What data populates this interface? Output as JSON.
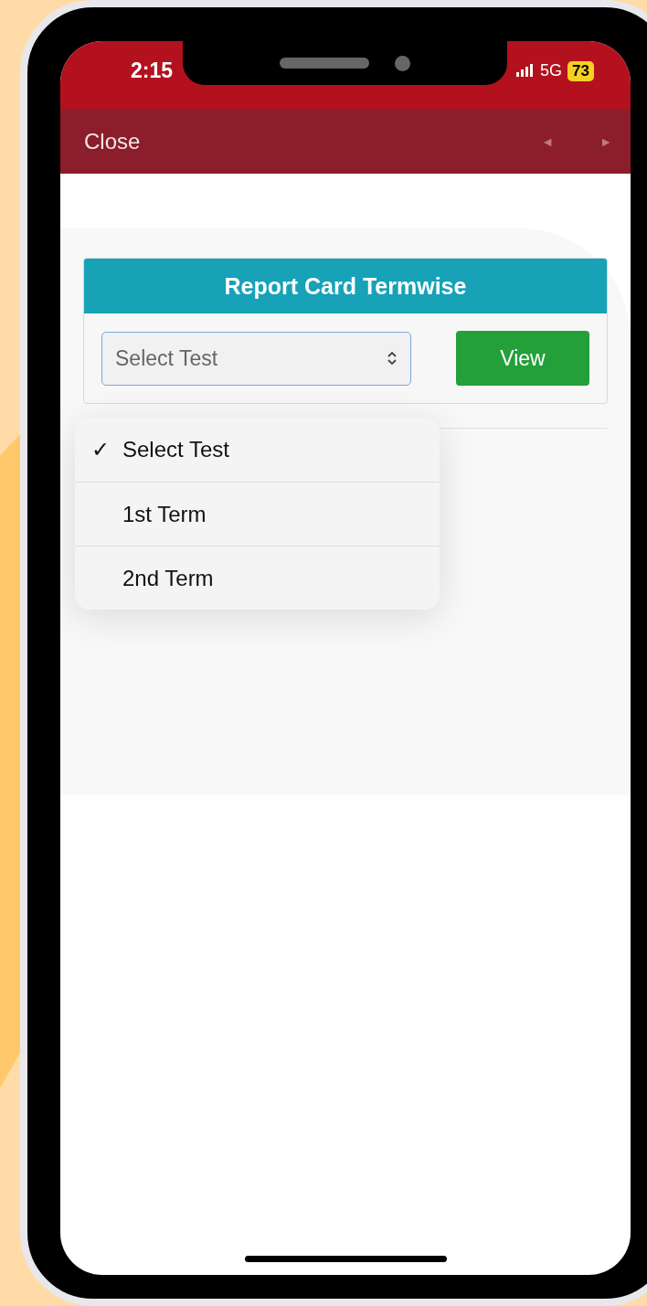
{
  "status_bar": {
    "time": "2:15",
    "network": "5G",
    "battery": "73"
  },
  "nav_bar": {
    "close": "Close",
    "arrows": [
      {
        "label": "◄",
        "disabled": true
      },
      {
        "label": "►",
        "disabled": true
      }
    ]
  },
  "card": {
    "title": "Report Card Termwise",
    "select": {
      "value": "Select Test"
    },
    "button": "View"
  },
  "dropdown": {
    "check": "✓",
    "options": [
      {
        "label": "Select Test",
        "selected": true
      },
      {
        "label": "1st Term",
        "selected": false
      },
      {
        "label": "2nd Term",
        "selected": false
      }
    ]
  }
}
